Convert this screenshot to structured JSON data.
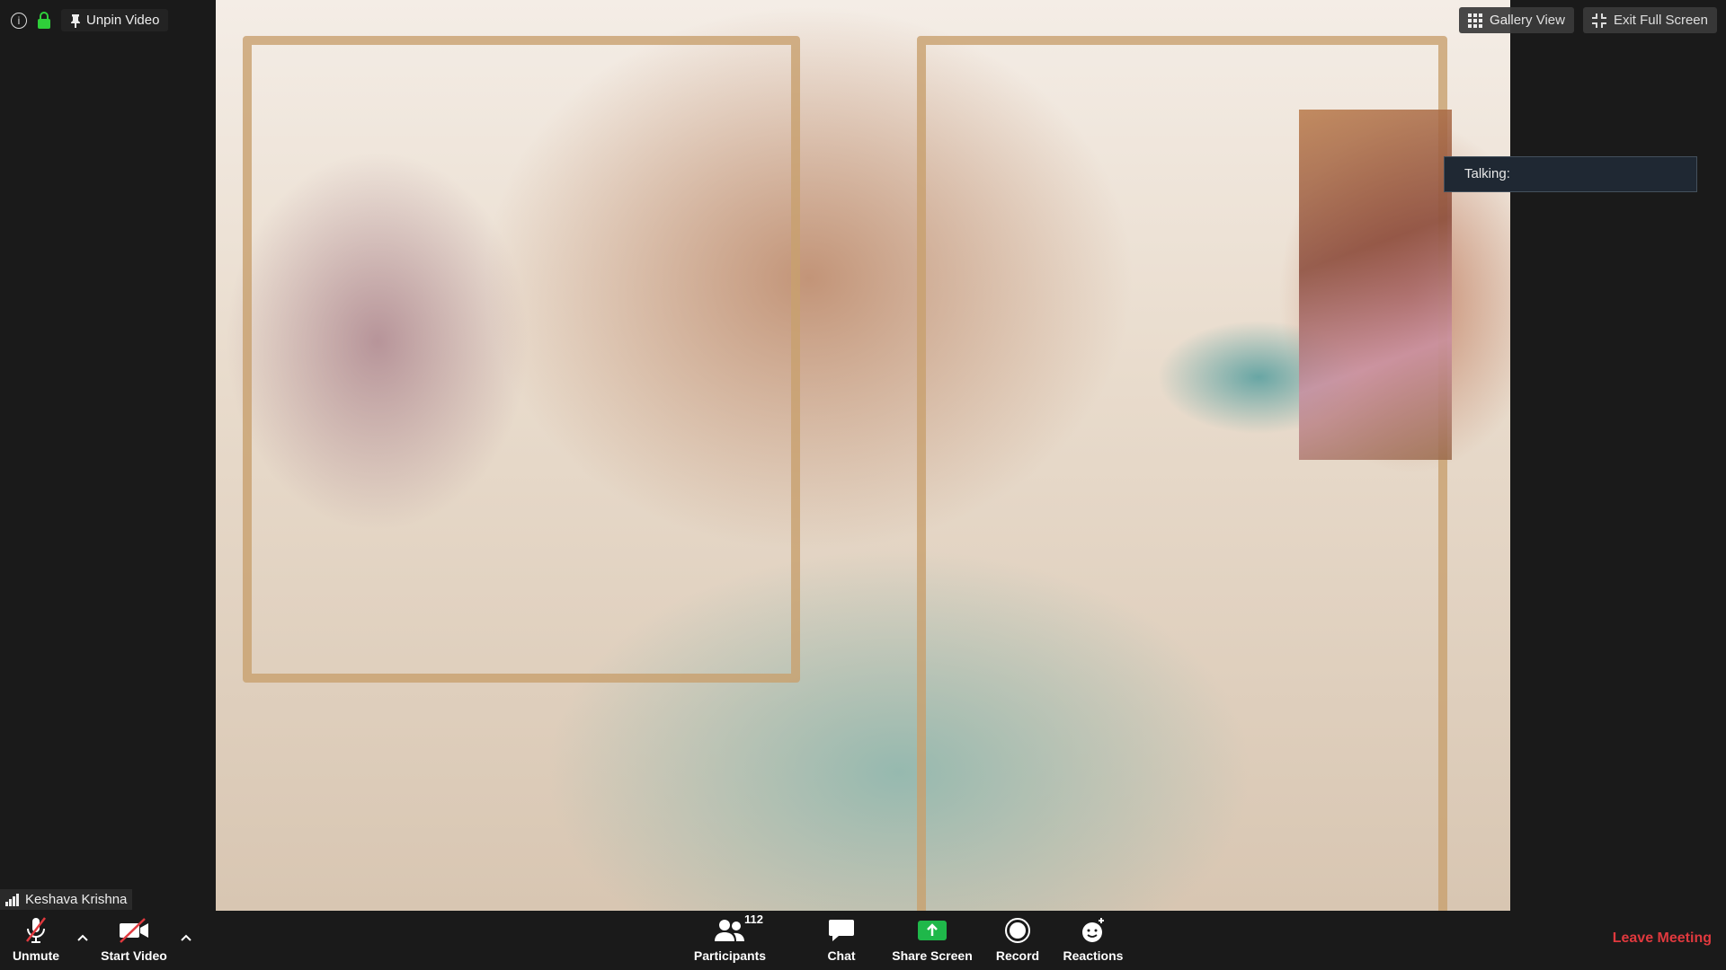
{
  "top_left": {
    "unpin_label": "Unpin Video"
  },
  "top_right": {
    "gallery_label": "Gallery View",
    "exit_fullscreen_label": "Exit Full Screen"
  },
  "talking": {
    "label": "Talking:"
  },
  "speaker": {
    "name": "Keshava Krishna"
  },
  "toolbar": {
    "unmute_label": "Unmute",
    "start_video_label": "Start Video",
    "participants_label": "Participants",
    "participants_count": "112",
    "chat_label": "Chat",
    "share_label": "Share Screen",
    "record_label": "Record",
    "reactions_label": "Reactions",
    "leave_label": "Leave Meeting"
  },
  "colors": {
    "leave": "#e0393e",
    "share_green": "#1fb84a",
    "lock_green": "#2fcf3a",
    "mute_red": "#e0393e"
  }
}
